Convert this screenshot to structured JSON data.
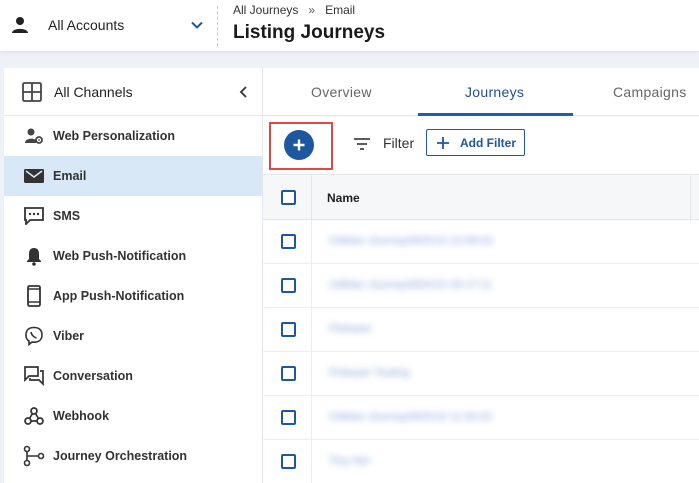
{
  "header": {
    "account_label": "All Accounts",
    "breadcrumb": [
      "All Journeys",
      "Email"
    ],
    "breadcrumb_separator": "»",
    "title": "Listing Journeys"
  },
  "sidebar": {
    "head_label": "All Channels",
    "items": [
      {
        "label": "Web Personalization",
        "icon": "person-gear-icon"
      },
      {
        "label": "Email",
        "icon": "envelope-icon",
        "active": true
      },
      {
        "label": "SMS",
        "icon": "sms-icon"
      },
      {
        "label": "Web Push-Notification",
        "icon": "bell-icon"
      },
      {
        "label": "App Push-Notification",
        "icon": "mobile-phone-icon"
      },
      {
        "label": "Viber",
        "icon": "viber-icon"
      },
      {
        "label": "Conversation",
        "icon": "conversation-icon"
      },
      {
        "label": "Webhook",
        "icon": "webhook-icon"
      },
      {
        "label": "Journey Orchestration",
        "icon": "orchestration-icon"
      }
    ]
  },
  "tabs": [
    "Overview",
    "Journeys",
    "Campaigns"
  ],
  "active_tab": "Journeys",
  "toolbar": {
    "create_symbol": "+",
    "filter_label": "Filter",
    "add_filter_label": "Add Filter"
  },
  "table": {
    "column_name": "Name",
    "rows": [
      "OdMan Journey0825/10 22:08:02",
      "OdMan Journey0825/10 00:17:11",
      "Pinkaser",
      "Pinkaser Testing",
      "OdMan Journey0825/10 11:30:02",
      "Tiny Net"
    ]
  },
  "colors": {
    "accent": "#1d57a0",
    "active_bg": "#d9e8f6",
    "highlight": "#e04848"
  }
}
